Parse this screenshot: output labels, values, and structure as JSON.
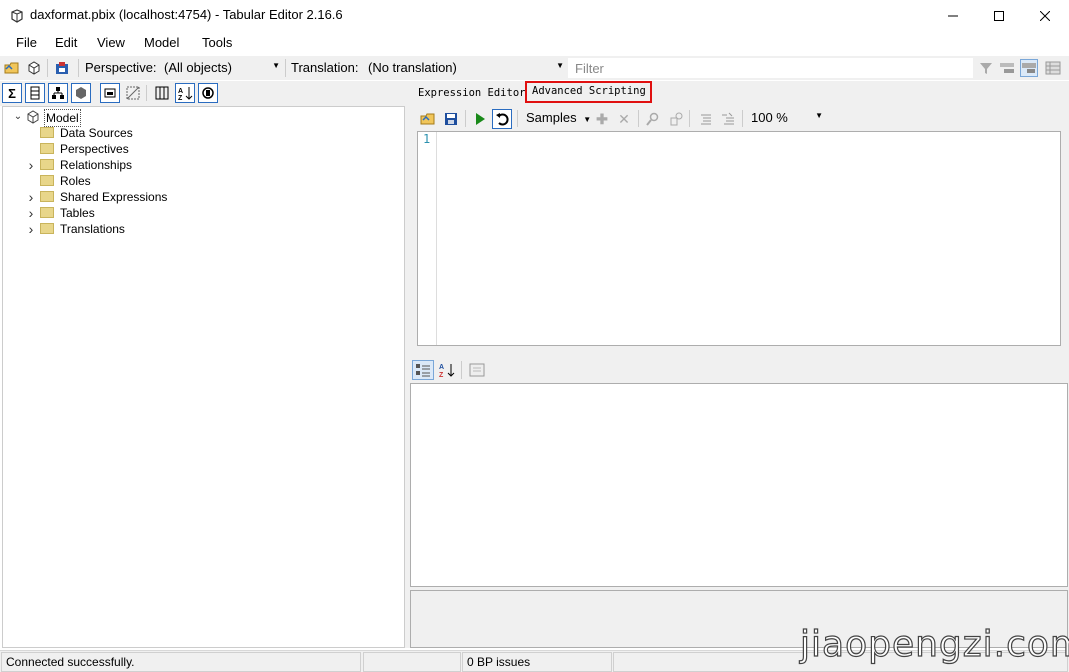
{
  "window": {
    "title": "daxformat.pbix (localhost:4754) - Tabular Editor 2.16.6",
    "controls": [
      "minimize-icon",
      "maximize-icon",
      "close-icon"
    ]
  },
  "menu": {
    "items": [
      "File",
      "Edit",
      "View",
      "Model",
      "Tools"
    ]
  },
  "toolbar": {
    "perspective_label": "Perspective:",
    "perspective_value": "(All objects)",
    "translation_label": "Translation:",
    "translation_value": "(No translation)",
    "filter_placeholder": "Filter"
  },
  "tree": {
    "root": "Model",
    "children": [
      {
        "label": "Data Sources",
        "expandable": false
      },
      {
        "label": "Perspectives",
        "expandable": false
      },
      {
        "label": "Relationships",
        "expandable": true
      },
      {
        "label": "Roles",
        "expandable": false
      },
      {
        "label": "Shared Expressions",
        "expandable": true
      },
      {
        "label": "Tables",
        "expandable": true
      },
      {
        "label": "Translations",
        "expandable": true
      }
    ]
  },
  "editor": {
    "tabs": [
      "Expression Editor",
      "Advanced Scripting"
    ],
    "active_tab": "Advanced Scripting",
    "samples_label": "Samples",
    "zoom": "100 %",
    "line_number": "1"
  },
  "status": {
    "message": "Connected successfully.",
    "bp_issues": "0 BP issues"
  },
  "watermark": "jiaopengzi.com",
  "colors": {
    "highlight_border": "#e01010",
    "folder": "#e8d68a",
    "line_number": "#2b91af",
    "run_green": "#1a8a1a"
  }
}
